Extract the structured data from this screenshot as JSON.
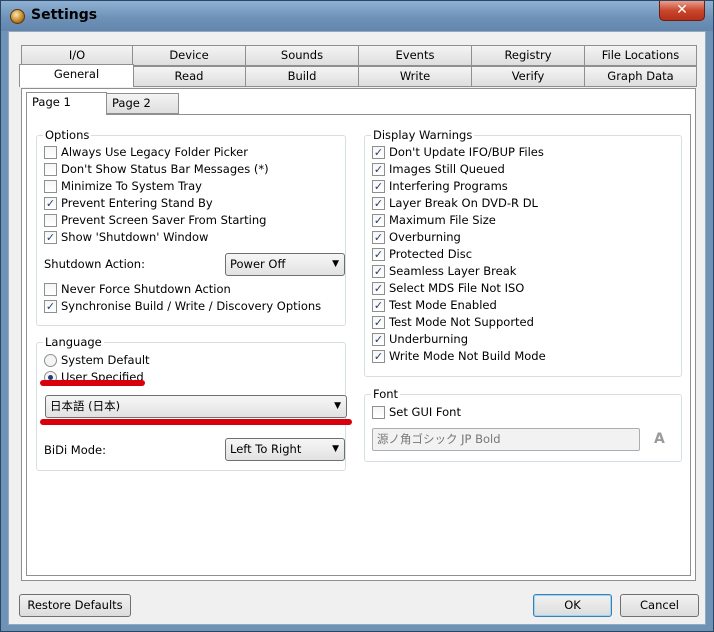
{
  "window": {
    "title": "Settings",
    "close_glyph": "✕"
  },
  "tabs_row1": [
    "I/O",
    "Device",
    "Sounds",
    "Events",
    "Registry",
    "File Locations"
  ],
  "tabs_row2": [
    "General",
    "Read",
    "Build",
    "Write",
    "Verify",
    "Graph Data"
  ],
  "active_tab": "General",
  "subtabs": [
    "Page 1",
    "Page 2"
  ],
  "active_subtab": "Page 1",
  "options": {
    "title": "Options",
    "items": [
      {
        "label": "Always Use Legacy Folder Picker",
        "checked": false
      },
      {
        "label": "Don't Show Status Bar Messages (*)",
        "checked": false
      },
      {
        "label": "Minimize To System Tray",
        "checked": false
      },
      {
        "label": "Prevent Entering Stand By",
        "checked": true
      },
      {
        "label": "Prevent Screen Saver From Starting",
        "checked": false
      },
      {
        "label": "Show 'Shutdown' Window",
        "checked": true
      }
    ],
    "shutdown_label": "Shutdown Action:",
    "shutdown_value": "Power Off",
    "items2": [
      {
        "label": "Never Force Shutdown Action",
        "checked": false
      },
      {
        "label": "Synchronise Build / Write / Discovery Options",
        "checked": true
      }
    ]
  },
  "language": {
    "title": "Language",
    "radio_system": "System Default",
    "radio_user": "User Specified",
    "selected": "User Specified",
    "language_value": "日本語 (日本)",
    "bidi_label": "BiDi Mode:",
    "bidi_value": "Left To Right"
  },
  "display_warnings": {
    "title": "Display Warnings",
    "items": [
      {
        "label": "Don't Update IFO/BUP Files",
        "checked": true
      },
      {
        "label": "Images Still Queued",
        "checked": true
      },
      {
        "label": "Interfering Programs",
        "checked": true
      },
      {
        "label": "Layer Break On DVD-R DL",
        "checked": true
      },
      {
        "label": "Maximum File Size",
        "checked": true
      },
      {
        "label": "Overburning",
        "checked": true
      },
      {
        "label": "Protected Disc",
        "checked": true
      },
      {
        "label": "Seamless Layer Break",
        "checked": true
      },
      {
        "label": "Select MDS File Not ISO",
        "checked": true
      },
      {
        "label": "Test Mode Enabled",
        "checked": true
      },
      {
        "label": "Test Mode Not Supported",
        "checked": true
      },
      {
        "label": "Underburning",
        "checked": true
      },
      {
        "label": "Write Mode Not Build Mode",
        "checked": true
      }
    ]
  },
  "font": {
    "title": "Font",
    "set_gui_font_label": "Set GUI Font",
    "set_gui_font_checked": false,
    "font_value": "源ノ角ゴシック JP Bold",
    "font_icon_glyph": "A"
  },
  "buttons": {
    "restore": "Restore Defaults",
    "ok": "OK",
    "cancel": "Cancel"
  },
  "colors": {
    "annotation_underline": "#d8000c",
    "title_bar": "#6f93b7"
  }
}
